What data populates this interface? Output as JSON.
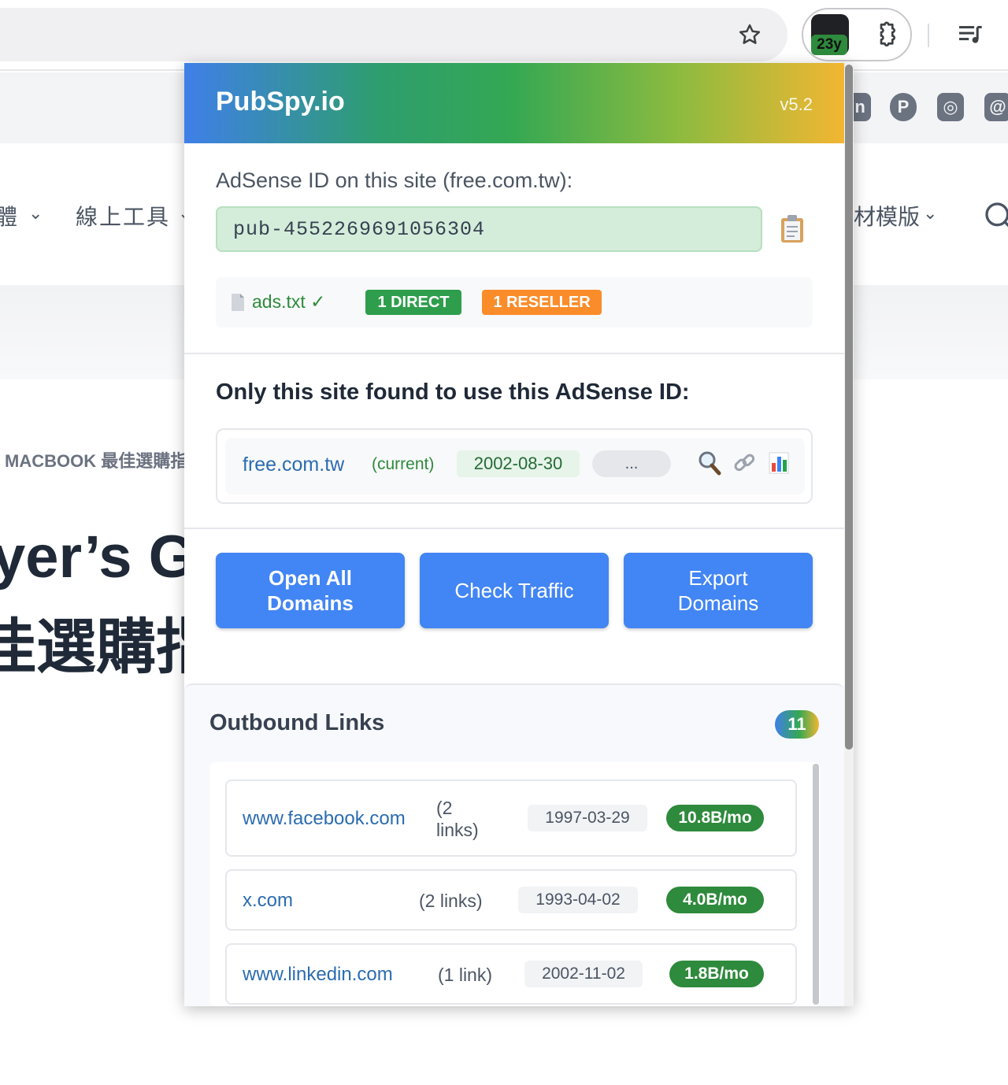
{
  "browser": {
    "extension_badge": "23y"
  },
  "site": {
    "social_icons": [
      "in",
      "P",
      "◎",
      "@"
    ],
    "nav_items": [
      {
        "label": "體",
        "chevron": "⌄"
      },
      {
        "label": "線上工具",
        "chevron": "⌄"
      },
      {
        "label": "材模版",
        "chevron": "⌄"
      }
    ],
    "breadcrumb": "MACBOOK 最佳選購指",
    "headline_line1": "yer’s G",
    "headline_line2": "佳選購指"
  },
  "popup": {
    "brand": "PubSpy.io",
    "version": "v5.2",
    "adsense_label": "AdSense ID on this site (free.com.tw):",
    "adsense_id": "pub-4552269691056304",
    "ads_txt": {
      "label": "ads.txt ✓",
      "direct": "1 DIRECT",
      "reseller": "1 RESELLER"
    },
    "only_site_heading": "Only this site found to use this AdSense ID:",
    "site_row": {
      "domain": "free.com.tw",
      "tag": "(current)",
      "date": "2002-08-30",
      "more": "..."
    },
    "buttons": {
      "open_all": "Open All Domains",
      "check_traffic": "Check Traffic",
      "export": "Export Domains"
    },
    "outbound": {
      "title": "Outbound Links",
      "count": "11",
      "rows": [
        {
          "domain": "www.facebook.com",
          "links": "(2 links)",
          "date": "1997-03-29",
          "traffic": "10.8B/mo"
        },
        {
          "domain": "x.com",
          "links": "(2 links)",
          "date": "1993-04-02",
          "traffic": "4.0B/mo"
        },
        {
          "domain": "www.linkedin.com",
          "links": "(1 link)",
          "date": "2002-11-02",
          "traffic": "1.8B/mo"
        }
      ]
    }
  },
  "colors": {
    "accent_blue": "#4285f4",
    "success_green": "#2e8a3c",
    "reseller_orange": "#fb8c2a"
  }
}
